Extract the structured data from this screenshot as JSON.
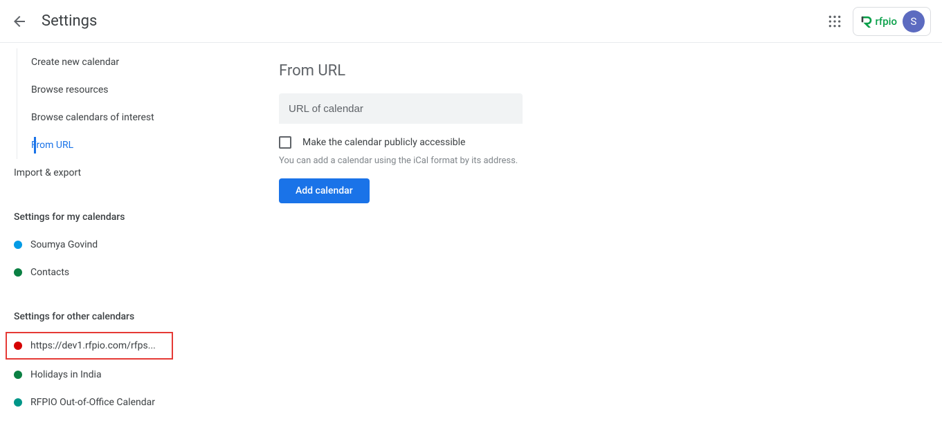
{
  "header": {
    "title": "Settings",
    "brand": "rfpio",
    "avatar_initial": "S"
  },
  "sidebar": {
    "nav_items": [
      {
        "label": "Create new calendar"
      },
      {
        "label": "Browse resources"
      },
      {
        "label": "Browse calendars of interest"
      },
      {
        "label": "From URL"
      }
    ],
    "top_level": {
      "label": "Import & export"
    },
    "section_my": {
      "header": "Settings for my calendars",
      "items": [
        {
          "label": "Soumya Govind",
          "color": "#039be5"
        },
        {
          "label": "Contacts",
          "color": "#0b8043"
        }
      ]
    },
    "section_other": {
      "header": "Settings for other calendars",
      "items": [
        {
          "label": "https://dev1.rfpio.com/rfps...",
          "color": "#d50000",
          "highlighted": true
        },
        {
          "label": "Holidays in India",
          "color": "#0b8043"
        },
        {
          "label": "RFPIO Out-of-Office Calendar",
          "color": "#009688"
        }
      ]
    }
  },
  "main": {
    "title": "From URL",
    "url_placeholder": "URL of calendar",
    "checkbox_label": "Make the calendar publicly accessible",
    "help_text": "You can add a calendar using the iCal format by its address.",
    "add_button": "Add calendar"
  }
}
